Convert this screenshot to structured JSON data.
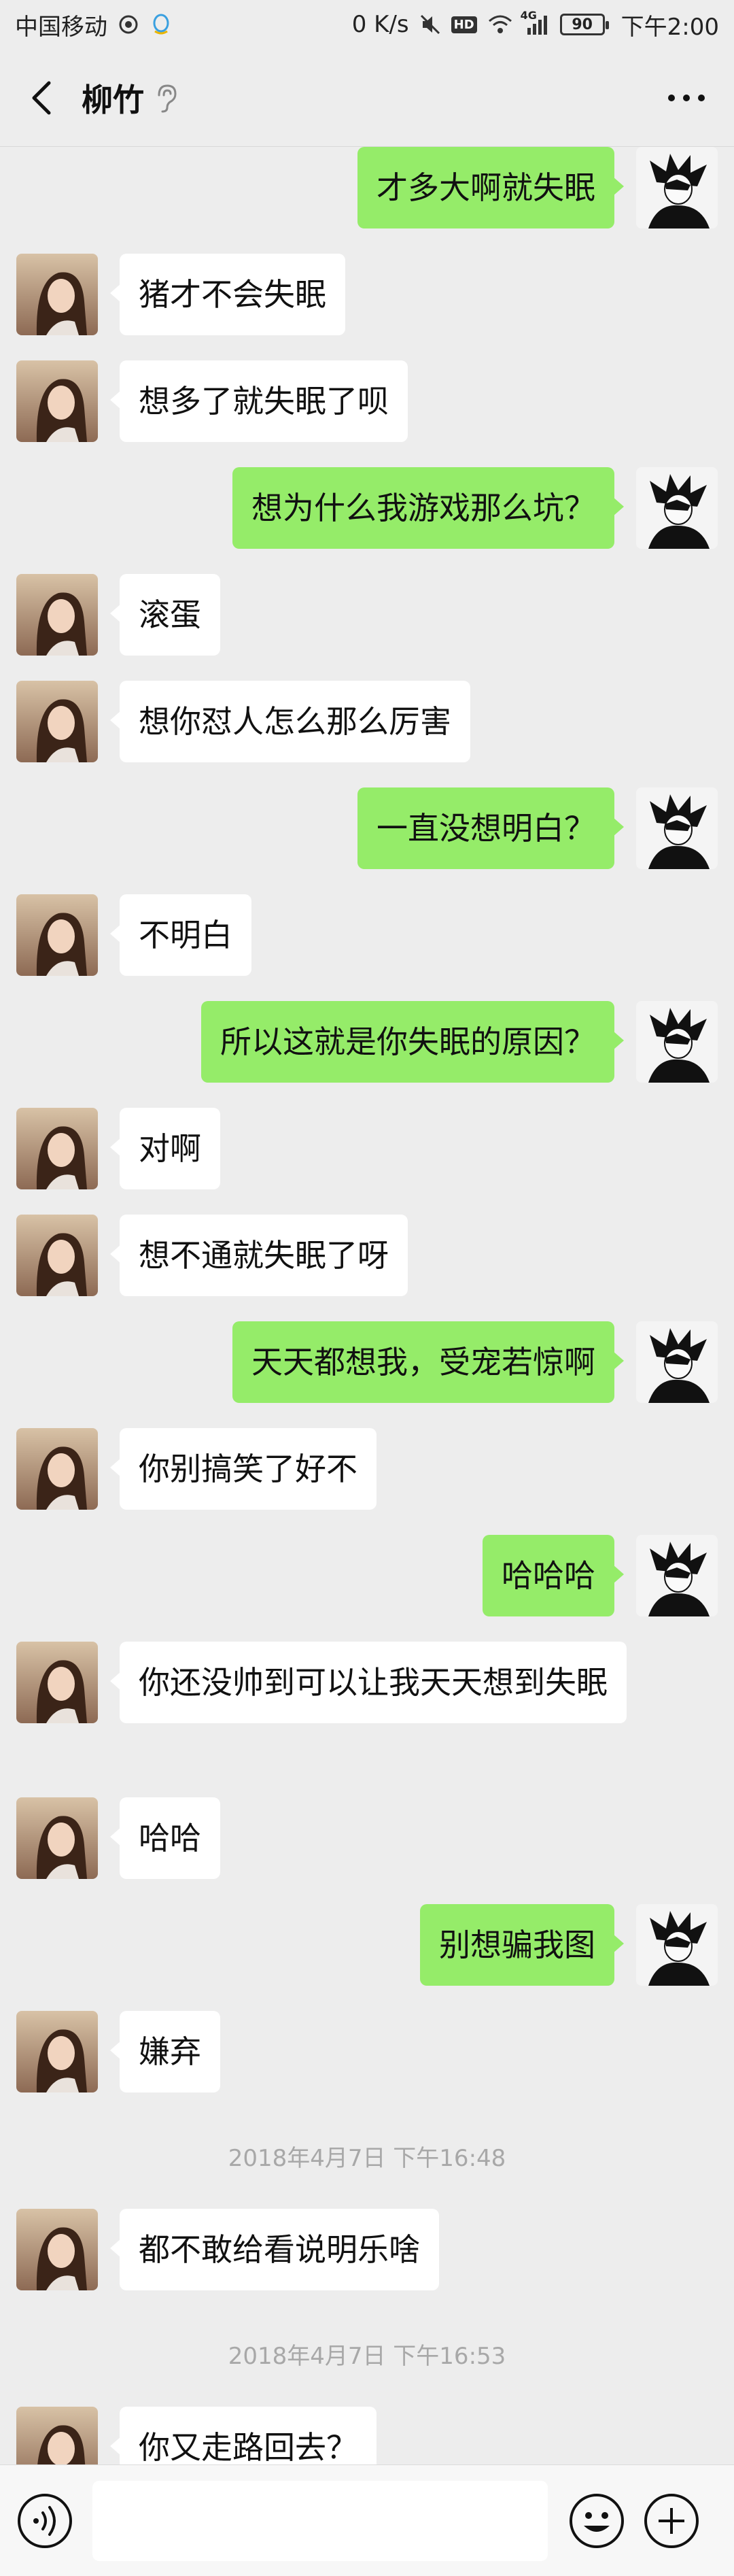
{
  "status_bar": {
    "carrier": "中国移动",
    "speed": "0 K/s",
    "network_badge": "HD",
    "signal_label": "4G",
    "battery": "90",
    "time": "下午2:00"
  },
  "header": {
    "title": "柳竹"
  },
  "messages": [
    {
      "side": "right",
      "text": "才多大啊就失眠"
    },
    {
      "side": "left",
      "text": "猪才不会失眠"
    },
    {
      "side": "left",
      "text": "想多了就失眠了呗"
    },
    {
      "side": "right",
      "text": "想为什么我游戏那么坑？"
    },
    {
      "side": "left",
      "text": "滚蛋"
    },
    {
      "side": "left",
      "text": "想你怼人怎么那么厉害"
    },
    {
      "side": "right",
      "text": "一直没想明白？"
    },
    {
      "side": "left",
      "text": "不明白"
    },
    {
      "side": "right",
      "text": "所以这就是你失眠的原因？"
    },
    {
      "side": "left",
      "text": "对啊"
    },
    {
      "side": "left",
      "text": "想不通就失眠了呀"
    },
    {
      "side": "right",
      "text": "天天都想我，受宠若惊啊"
    },
    {
      "side": "left",
      "text": "你别搞笑了好不"
    },
    {
      "side": "right",
      "text": "哈哈哈"
    },
    {
      "side": "left",
      "text": "你还没帅到可以让我天天想到失眠"
    },
    {
      "side": "left",
      "text": "哈哈"
    },
    {
      "side": "right",
      "text": "别想骗我图"
    },
    {
      "side": "left",
      "text": "嫌弃"
    },
    {
      "side": "left",
      "text": "都不敢给看说明乐啥"
    },
    {
      "side": "left",
      "text": "你又走路回去？"
    }
  ],
  "timestamps": [
    "2018年4月7日 下午16:48",
    "2018年4月7日 下午16:53"
  ],
  "input_bar": {
    "value": ""
  },
  "colors": {
    "background": "#ededed",
    "own_bubble": "#95ec69",
    "other_bubble": "#ffffff",
    "timestamp_text": "#a8a8a8"
  }
}
